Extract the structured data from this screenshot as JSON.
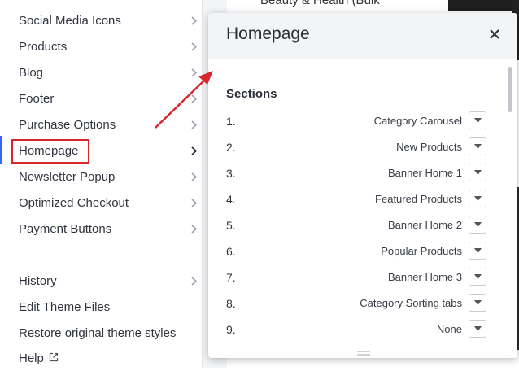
{
  "sidebar": {
    "items": [
      {
        "label": "Social Media Icons"
      },
      {
        "label": "Products"
      },
      {
        "label": "Blog"
      },
      {
        "label": "Footer"
      },
      {
        "label": "Purchase Options"
      },
      {
        "label": "Homepage"
      },
      {
        "label": "Newsletter Popup"
      },
      {
        "label": "Optimized Checkout"
      },
      {
        "label": "Payment Buttons"
      }
    ],
    "bottom_items": [
      {
        "label": "History"
      },
      {
        "label": "Edit Theme Files"
      },
      {
        "label": "Restore original theme styles"
      },
      {
        "label": "Help"
      }
    ],
    "active": "Homepage"
  },
  "preview": {
    "partial_text": "Beauty & Health (Bulk"
  },
  "panel": {
    "title": "Homepage",
    "sections_title": "Sections",
    "sections": [
      {
        "number": "1.",
        "value": "Category Carousel"
      },
      {
        "number": "2.",
        "value": "New Products"
      },
      {
        "number": "3.",
        "value": "Banner Home 1"
      },
      {
        "number": "4.",
        "value": "Featured Products"
      },
      {
        "number": "5.",
        "value": "Banner Home 2"
      },
      {
        "number": "6.",
        "value": "Popular Products"
      },
      {
        "number": "7.",
        "value": "Banner Home 3"
      },
      {
        "number": "8.",
        "value": "Category Sorting tabs"
      },
      {
        "number": "9.",
        "value": "None"
      }
    ]
  },
  "colors": {
    "accent": "#3c64f4",
    "annotation": "#d9252c"
  },
  "icons": {
    "chevron": "chevron-right-icon",
    "external": "external-link-icon",
    "close": "close-icon",
    "dropdown": "chevron-down-icon"
  }
}
